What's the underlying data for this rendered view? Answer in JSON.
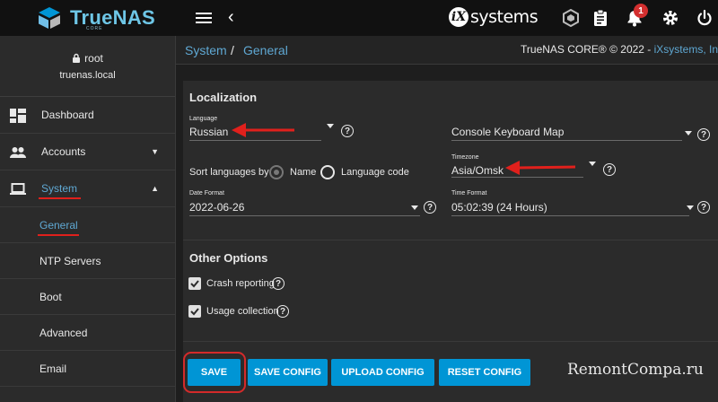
{
  "header": {
    "logo_text": "TrueNAS",
    "logo_sub": "CORE",
    "vendor_text": "systems",
    "vendor_mark": "iX",
    "notification_count": "1"
  },
  "sidebar": {
    "username": "root",
    "hostname": "truenas.local",
    "items": [
      {
        "label": "Dashboard",
        "icon": "dashboard-icon"
      },
      {
        "label": "Accounts",
        "icon": "people-icon"
      },
      {
        "label": "System",
        "icon": "laptop-icon"
      }
    ],
    "subitems": [
      {
        "label": "General"
      },
      {
        "label": "NTP Servers"
      },
      {
        "label": "Boot"
      },
      {
        "label": "Advanced"
      },
      {
        "label": "Email"
      }
    ]
  },
  "breadcrumb": {
    "root": "System",
    "separator": "/",
    "current": "General",
    "copyright": "TrueNAS CORE® © 2022 - ",
    "copyright_link": "iXsystems, In"
  },
  "localization": {
    "title": "Localization",
    "language_label": "Language",
    "language_value": "Russian",
    "keyboard_label": "Console Keyboard Map",
    "sort_label": "Sort languages by:",
    "sort_option_name": "Name",
    "sort_option_code": "Language code",
    "timezone_label": "Timezone",
    "timezone_value": "Asia/Omsk",
    "date_label": "Date Format",
    "date_value": "2022-06-26",
    "time_label": "Time Format",
    "time_value": "05:02:39 (24 Hours)"
  },
  "other": {
    "title": "Other Options",
    "crash_label": "Crash reporting",
    "usage_label": "Usage collection"
  },
  "buttons": {
    "save": "SAVE",
    "save_config": "SAVE CONFIG",
    "upload_config": "UPLOAD CONFIG",
    "reset_config": "RESET CONFIG"
  },
  "watermark": "RemontCompa.ru",
  "colors": {
    "accent": "#0095d5",
    "link": "#5fa8d3",
    "annotation": "#e0201c"
  }
}
